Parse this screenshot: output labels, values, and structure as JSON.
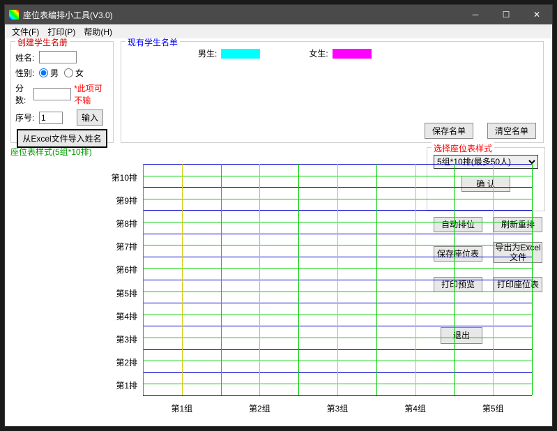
{
  "window": {
    "title": "座位表编排小工具(V3.0)"
  },
  "menu": {
    "file": "文件(F)",
    "print": "打印(P)",
    "help": "帮助(H)"
  },
  "create": {
    "title": "创建学生名册",
    "name_label": "姓名:",
    "gender_label": "性别:",
    "gender_male": "男",
    "gender_female": "女",
    "score_label": "分数:",
    "score_hint": "*此项可不输",
    "seq_label": "序号:",
    "seq_value": "1",
    "enter_btn": "输入",
    "import_btn": "从Excel文件导入姓名"
  },
  "existing": {
    "title": "现有学生名单",
    "male_label": "男生:",
    "female_label": "女生:",
    "male_color": "#00ffff",
    "female_color": "#ff00ff",
    "save_btn": "保存名单",
    "clear_btn": "清空名单"
  },
  "layout_label": "座位表样式(5组*10排)",
  "style_box": {
    "title": "选择座位表样式",
    "selected": "5组*10排(最多50人)",
    "confirm_btn": "确  认"
  },
  "actions": {
    "auto": "自动排位",
    "refresh": "刷新重排",
    "save": "保存座位表",
    "export": "导出为Excel文件",
    "preview": "打印预览",
    "print_seat": "打印座位表",
    "exit": "退出"
  },
  "chart_data": {
    "type": "table",
    "rows": [
      "第10排",
      "第9排",
      "第8排",
      "第7排",
      "第6排",
      "第5排",
      "第4排",
      "第3排",
      "第2排",
      "第1排"
    ],
    "cols": [
      "第1组",
      "第2组",
      "第3组",
      "第4组",
      "第5组"
    ],
    "row_count": 10,
    "col_count": 5,
    "green": "#00cc00",
    "blue": "#0000cc",
    "yellow": "#cccc00"
  }
}
